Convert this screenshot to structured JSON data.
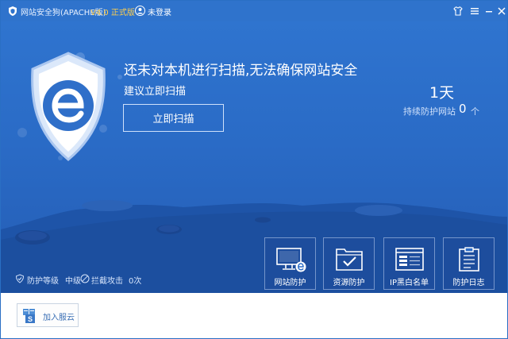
{
  "titlebar": {
    "app_name": "网站安全狗(APACHE版)",
    "version": "V4.0 正式版",
    "login_status": "未登录"
  },
  "hero": {
    "headline": "还未对本机进行扫描,无法确保网站安全",
    "subline": "建议立即扫描",
    "scan_button": "立即扫描",
    "days": "1天",
    "protected_label": "持续防护网站",
    "protected_count": "0",
    "protected_unit": "个"
  },
  "status": {
    "level_label": "防护等级",
    "level_value": "中级",
    "attack_label": "拦截攻击",
    "attack_value": "0次"
  },
  "tiles": [
    {
      "label": "网站防护",
      "icon": "website-protect-icon"
    },
    {
      "label": "资源防护",
      "icon": "resource-protect-icon"
    },
    {
      "label": "IP黑白名单",
      "icon": "ip-list-icon"
    },
    {
      "label": "防护日志",
      "icon": "log-icon"
    }
  ],
  "footer": {
    "cloud_button": "加入服云"
  },
  "colors": {
    "titlebar": "#2f73cc",
    "hero_top": "#2f74cf",
    "hero_bottom": "#245cb4",
    "version_accent": "#ffcf4d",
    "shield_e": "#2f6fc9"
  }
}
